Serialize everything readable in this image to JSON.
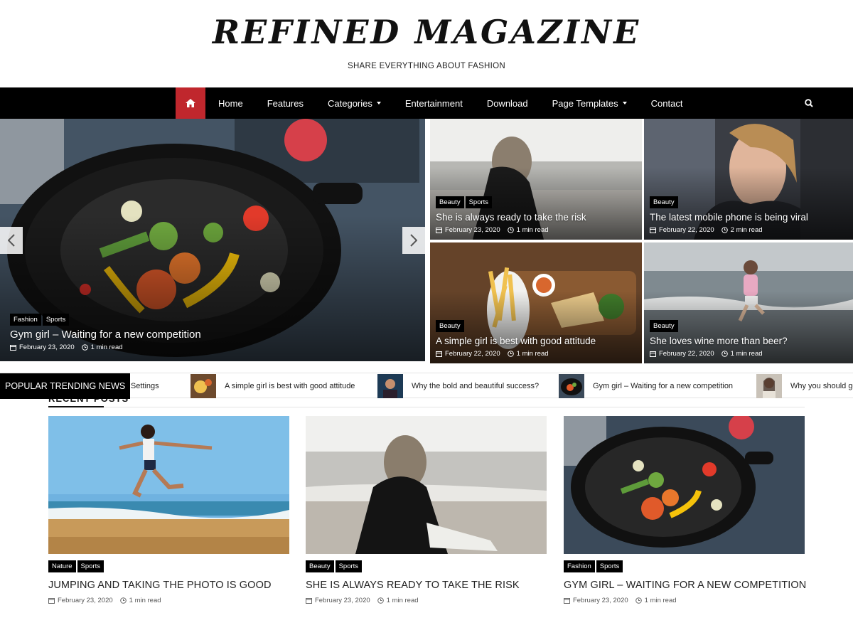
{
  "site": {
    "title": "REFINED MAGAZINE",
    "tagline": "SHARE EVERYTHING ABOUT FASHION"
  },
  "nav": {
    "items": [
      {
        "label": "Home",
        "has_dropdown": false
      },
      {
        "label": "Features",
        "has_dropdown": false
      },
      {
        "label": "Categories",
        "has_dropdown": true
      },
      {
        "label": "Entertainment",
        "has_dropdown": false
      },
      {
        "label": "Download",
        "has_dropdown": false
      },
      {
        "label": "Page Templates",
        "has_dropdown": true
      },
      {
        "label": "Contact",
        "has_dropdown": false
      }
    ],
    "home_icon": "home-icon",
    "search_icon": "search-icon",
    "accent_color": "#c0272d"
  },
  "featured": {
    "slider": {
      "tags": [
        "Fashion",
        "Sports"
      ],
      "title": "Gym girl – Waiting for a new competition",
      "date": "February 23, 2020",
      "read_time": "1 min read"
    },
    "tiles": [
      {
        "tags": [
          "Beauty",
          "Sports"
        ],
        "title": "She is always ready to take the risk",
        "date": "February 23, 2020",
        "read_time": "1 min read"
      },
      {
        "tags": [
          "Beauty"
        ],
        "title": "The latest mobile phone is being viral",
        "date": "February 22, 2020",
        "read_time": "2 min read"
      },
      {
        "tags": [
          "Beauty"
        ],
        "title": "A simple girl is best with good attitude",
        "date": "February 22, 2020",
        "read_time": "1 min read"
      },
      {
        "tags": [
          "Beauty"
        ],
        "title": "She loves wine more than beer?",
        "date": "February 22, 2020",
        "read_time": "1 min read"
      }
    ]
  },
  "ticker": {
    "label": "POPULAR TRENDING NEWS",
    "items": [
      "ter Settings",
      "A simple girl is best with good attitude",
      "Why the bold and beautiful success?",
      "Gym girl – Waiting for a new competition",
      "Why you should go"
    ]
  },
  "recent": {
    "heading": "RECENT POSTS",
    "posts": [
      {
        "tags": [
          "Nature",
          "Sports"
        ],
        "title": "JUMPING AND TAKING THE PHOTO IS GOOD",
        "date": "February 23, 2020",
        "read_time": "1 min read"
      },
      {
        "tags": [
          "Beauty",
          "Sports"
        ],
        "title": "SHE IS ALWAYS READY TO TAKE THE RISK",
        "date": "February 23, 2020",
        "read_time": "1 min read"
      },
      {
        "tags": [
          "Fashion",
          "Sports"
        ],
        "title": "GYM GIRL – WAITING FOR A NEW COMPETITION",
        "date": "February 23, 2020",
        "read_time": "1 min read"
      }
    ]
  }
}
